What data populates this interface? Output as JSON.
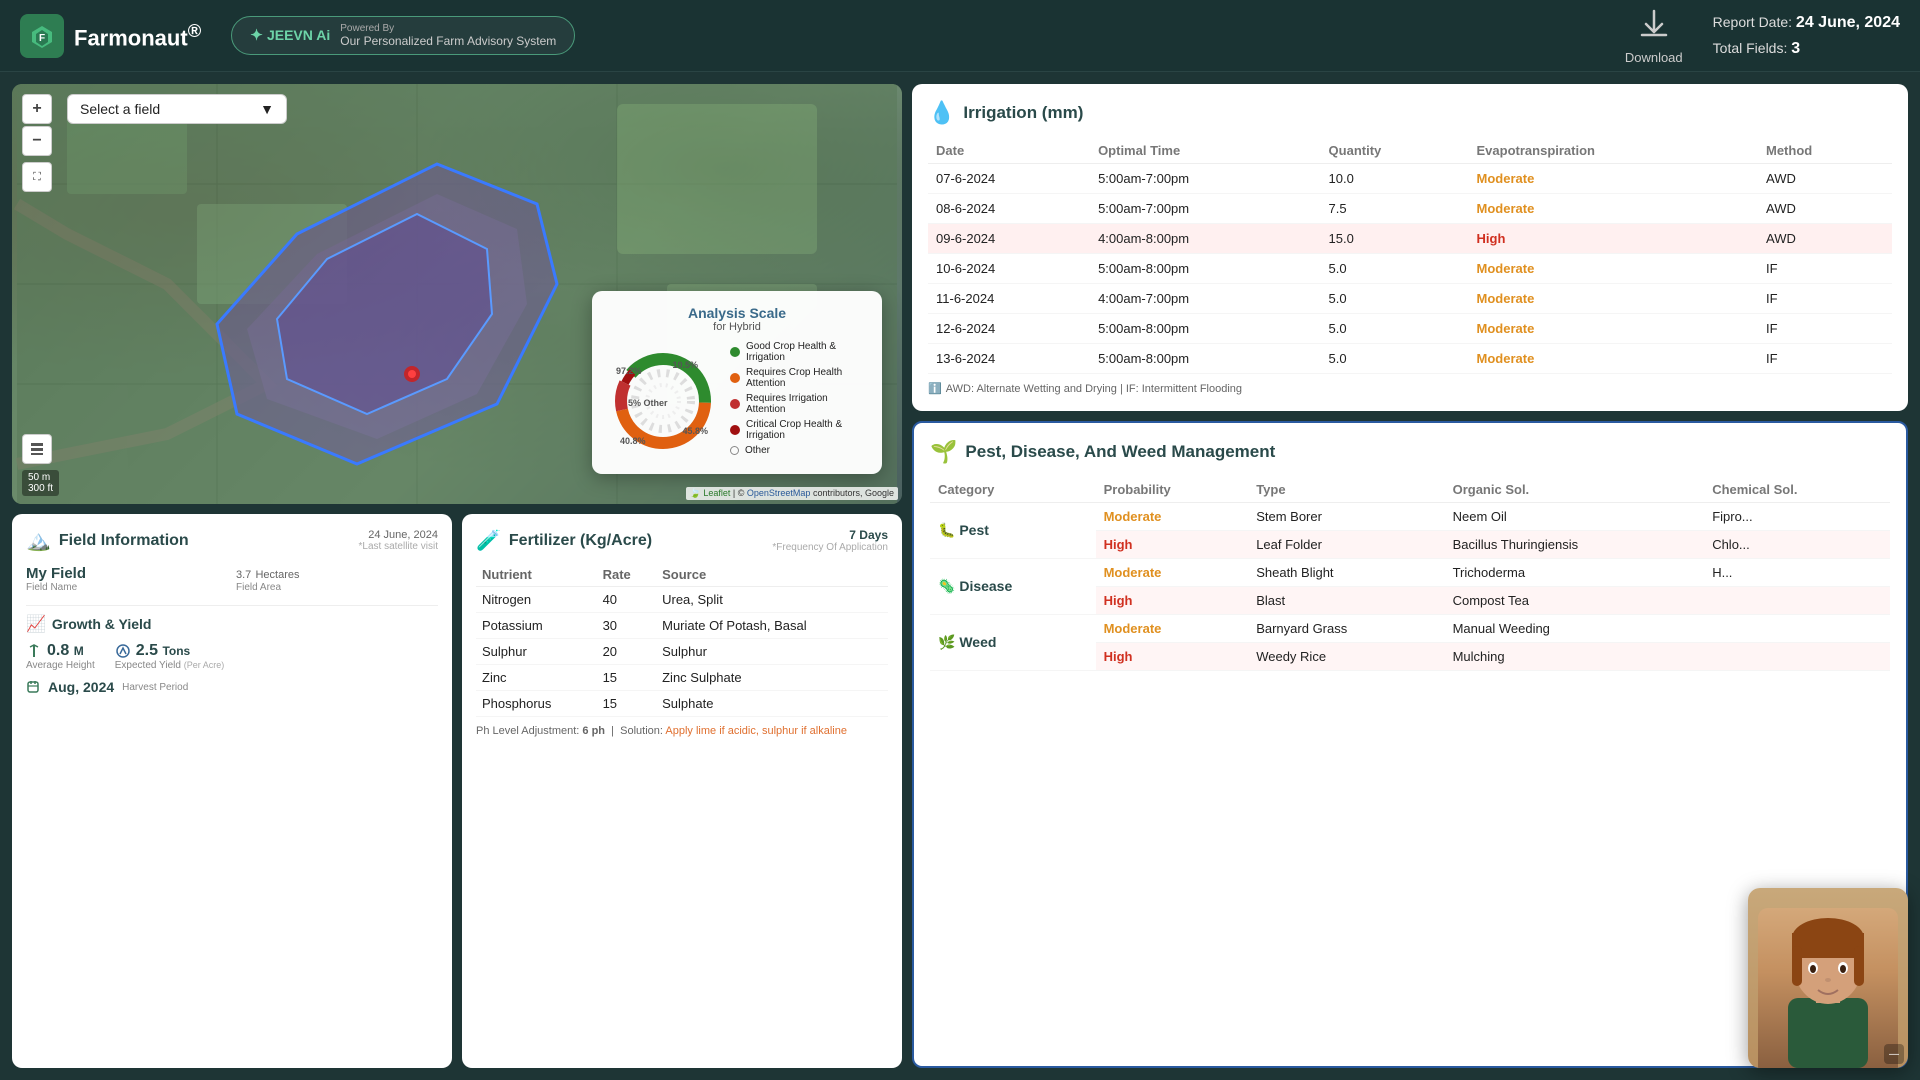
{
  "app": {
    "name": "Farmonaut",
    "registered": "®"
  },
  "jeevn": {
    "label": "JEEVN Ai",
    "powered_by": "Powered By",
    "description": "Our Personalized Farm Advisory System"
  },
  "header": {
    "download_label": "Download",
    "report_date_label": "Report Date:",
    "report_date": "24 June, 2024",
    "total_fields_label": "Total Fields:",
    "total_fields": "3"
  },
  "map": {
    "field_select_placeholder": "Select a field",
    "zoom_in": "+",
    "zoom_out": "−",
    "scale_50m": "50 m",
    "scale_300ft": "300 ft",
    "attribution": "Leaflet | © OpenStreetMap contributors, Google"
  },
  "analysis_scale": {
    "title": "Analysis Scale",
    "subtitle": "for Hybrid",
    "pct_97": "97.2%",
    "pct_10": "10.5%",
    "pct_45": "45.8%",
    "pct_40": "40.8%",
    "pct_5_other": "5% Other",
    "legend": [
      {
        "label": "Good Crop Health & Irrigation",
        "color": "#2e8b2e"
      },
      {
        "label": "Requires Crop Health Attention",
        "color": "#e06010"
      },
      {
        "label": "Requires Irrigation Attention",
        "color": "#c03030"
      },
      {
        "label": "Critical Crop Health & Irrigation",
        "color": "#a01010"
      },
      {
        "label": "Other",
        "color": ""
      }
    ]
  },
  "field_info": {
    "title": "Field Information",
    "date": "24 June, 2024",
    "last_visit": "*Last satellite visit",
    "field_name_label": "Field Name",
    "field_name": "My Field",
    "field_area_label": "Field Area",
    "field_area": "3.7",
    "field_area_unit": "Hectares",
    "growth_title": "Growth & Yield",
    "avg_height_label": "Average Height",
    "avg_height": "0.8",
    "avg_height_unit": "M",
    "expected_yield_label": "Expected Yield",
    "expected_yield": "2.5",
    "expected_yield_unit": "Tons",
    "per_acre": "(Per Acre)",
    "harvest_label": "Harvest Period",
    "harvest": "Aug, 2024"
  },
  "fertilizer": {
    "title": "Fertilizer (Kg/Acre)",
    "days_label": "7 Days",
    "freq_label": "*Frequency Of Application",
    "columns": [
      "Nutrient",
      "Rate",
      "Source"
    ],
    "rows": [
      {
        "nutrient": "Nitrogen",
        "rate": "40",
        "source": "Urea, Split"
      },
      {
        "nutrient": "Potassium",
        "rate": "30",
        "source": "Muriate Of Potash, Basal"
      },
      {
        "nutrient": "Sulphur",
        "rate": "20",
        "source": "Sulphur"
      },
      {
        "nutrient": "Zinc",
        "rate": "15",
        "source": "Zinc Sulphate"
      },
      {
        "nutrient": "Phosphorus",
        "rate": "15",
        "source": "Sulphate"
      }
    ],
    "ph_label": "Ph Level Adjustment:",
    "ph_value": "6 ph",
    "solution_label": "Solution:",
    "solution": "Apply lime if acidic, sulphur if alkaline"
  },
  "irrigation": {
    "title": "Irrigation (mm)",
    "columns": [
      "Date",
      "Optimal Time",
      "Quantity",
      "Evapotranspiration",
      "Method"
    ],
    "rows": [
      {
        "date": "07-6-2024",
        "time": "5:00am-7:00pm",
        "qty": "10.0",
        "evap": "Moderate",
        "method": "AWD",
        "highlighted": false
      },
      {
        "date": "08-6-2024",
        "time": "5:00am-7:00pm",
        "qty": "7.5",
        "evap": "Moderate",
        "method": "AWD",
        "highlighted": false
      },
      {
        "date": "09-6-2024",
        "time": "4:00am-8:00pm",
        "qty": "15.0",
        "evap": "High",
        "method": "AWD",
        "highlighted": true
      },
      {
        "date": "10-6-2024",
        "time": "5:00am-8:00pm",
        "qty": "5.0",
        "evap": "Moderate",
        "method": "IF",
        "highlighted": false
      },
      {
        "date": "11-6-2024",
        "time": "4:00am-7:00pm",
        "qty": "5.0",
        "evap": "Moderate",
        "method": "IF",
        "highlighted": false
      },
      {
        "date": "12-6-2024",
        "time": "5:00am-8:00pm",
        "qty": "5.0",
        "evap": "Moderate",
        "method": "IF",
        "highlighted": false
      },
      {
        "date": "13-6-2024",
        "time": "5:00am-8:00pm",
        "qty": "5.0",
        "evap": "Moderate",
        "method": "IF",
        "highlighted": false
      }
    ],
    "footer": "AWD: Alternate Wetting and Drying | IF: Intermittent Flooding"
  },
  "pest": {
    "title": "Pest, Disease, And Weed Management",
    "columns": [
      "Category",
      "Probability",
      "Type",
      "Organic Sol.",
      "Chemical Sol."
    ],
    "categories": [
      {
        "name": "Pest",
        "icon": "🐛",
        "rows": [
          {
            "prob": "Moderate",
            "type": "Stem Borer",
            "organic": "Neem Oil",
            "chemical": "Fipro...",
            "high": false
          },
          {
            "prob": "High",
            "type": "Leaf Folder",
            "organic": "Bacillus Thuringiensis",
            "chemical": "Chlo...",
            "high": true
          }
        ]
      },
      {
        "name": "Disease",
        "icon": "🦠",
        "rows": [
          {
            "prob": "Moderate",
            "type": "Sheath Blight",
            "organic": "Trichoderma",
            "chemical": "H...",
            "high": false
          },
          {
            "prob": "High",
            "type": "Blast",
            "organic": "Compost Tea",
            "chemical": "",
            "high": true
          }
        ]
      },
      {
        "name": "Weed",
        "icon": "🌿",
        "rows": [
          {
            "prob": "Moderate",
            "type": "Barnyard Grass",
            "organic": "Manual Weeding",
            "chemical": "",
            "high": false
          },
          {
            "prob": "High",
            "type": "Weedy Rice",
            "organic": "Mulching",
            "chemical": "",
            "high": true
          }
        ]
      }
    ]
  }
}
